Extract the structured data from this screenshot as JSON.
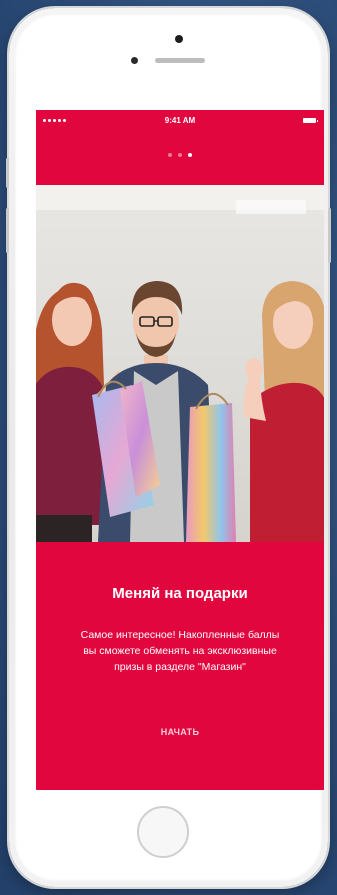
{
  "status_bar": {
    "time": "9:41 AM"
  },
  "onboarding": {
    "page_count": 3,
    "active_page": 3,
    "title": "Меняй на подарки",
    "body_lines": [
      "Самое интересное! Накопленные баллы",
      "вы сможете обменять на эксклюзивные",
      "призы в разделе \"Магазин\""
    ],
    "start_button_label": "НАЧАТЬ"
  },
  "colors": {
    "brand_red": "#e2063f",
    "text": "#ffffff",
    "backdrop": "#2f507d"
  },
  "icons": {
    "signal": "signal-dots-icon",
    "battery": "battery-icon"
  }
}
